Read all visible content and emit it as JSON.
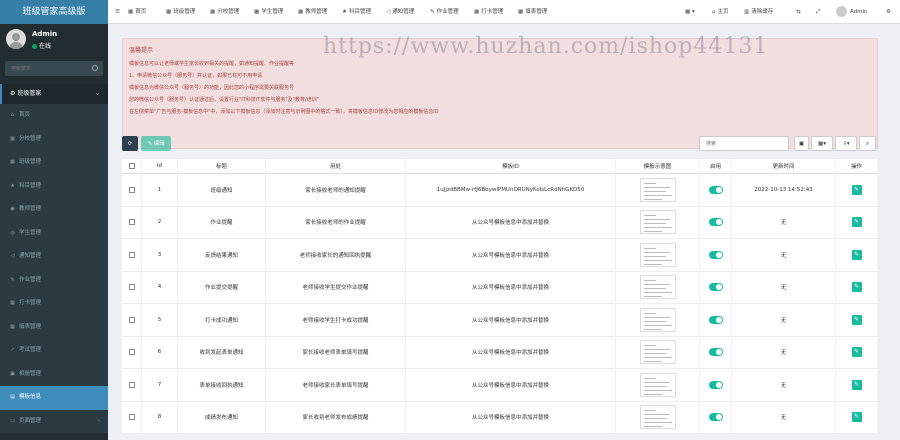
{
  "app": {
    "brand": "班级管家高级版"
  },
  "user": {
    "name": "Admin",
    "status": "在线"
  },
  "sidebar": {
    "search_placeholder": "搜索菜单",
    "group_label": "班级管家",
    "items": [
      {
        "label": "首页",
        "icon": "home-icon"
      },
      {
        "label": "分校管理",
        "icon": "grid-icon"
      },
      {
        "label": "班级管理",
        "icon": "grid-icon"
      },
      {
        "label": "科目管理",
        "icon": "star-icon"
      },
      {
        "label": "教师管理",
        "icon": "user-icon"
      },
      {
        "label": "学生管理",
        "icon": "users-icon"
      },
      {
        "label": "通知管理",
        "icon": "bullhorn-icon"
      },
      {
        "label": "作业管理",
        "icon": "edit-icon"
      },
      {
        "label": "打卡管理",
        "icon": "grid-icon"
      },
      {
        "label": "填表管理",
        "icon": "grid-icon"
      },
      {
        "label": "考试管理",
        "icon": "check-icon"
      },
      {
        "label": "相册管理",
        "icon": "image-icon"
      },
      {
        "label": "模板信息",
        "icon": "table-icon",
        "active": true
      },
      {
        "label": "页面管理",
        "icon": "page-icon"
      }
    ]
  },
  "topbar": {
    "nav": [
      {
        "label": "首页",
        "icon": "grid-icon"
      },
      {
        "label": "班级管理",
        "icon": "grid-icon"
      },
      {
        "label": "分校管理",
        "icon": "grid-icon"
      },
      {
        "label": "学生管理",
        "icon": "grid-icon"
      },
      {
        "label": "教师管理",
        "icon": "grid-icon"
      },
      {
        "label": "科目管理",
        "icon": "star-icon"
      },
      {
        "label": "通知管理",
        "icon": "bullhorn-icon"
      },
      {
        "label": "作业管理",
        "icon": "edit-icon"
      },
      {
        "label": "打卡管理",
        "icon": "grid-icon"
      },
      {
        "label": "填表管理",
        "icon": "grid-icon"
      }
    ],
    "home_label": "主页",
    "clear_cache_label": "清除缓存",
    "admin_label": "Admin"
  },
  "alert": {
    "title": "温馨提示",
    "lines": [
      "模板信息可以让老师或学生家长收到相关的提醒，如通知提醒、作业提醒等",
      "1、申请微信公众号（服务号）并认证，如果已有可不用申请",
      "模板信息为微信公众号（服务号）的功能，因此您的小程序需要关联服务号",
      "您的微信公众号（服务号）认证通过后，设置行业\"IT科技IT软件与服务\"及\"教育/培训\"",
      "在左侧菜单\"广告与服务-模板信息中\"中，添加以下模板信息（添加时注意与示例图中的格式一致），将模板信息ID修改为您相应的模板信息ID"
    ]
  },
  "watermark": "https://www.huzhan.com/ishop44131",
  "toolbar": {
    "add_label": "✎ 编辑",
    "search_placeholder": "搜索"
  },
  "table": {
    "headers": [
      "Id",
      "标题",
      "用处",
      "模板ID",
      "模板示意图",
      "启用",
      "更新时间",
      "操作"
    ],
    "rows": [
      {
        "id": "1",
        "title": "班级通知",
        "usage": "家长接收老师的通知提醒",
        "template_id": "1uJjzdBBMw-rfJ6BbywlPMUnORUNyKoIsLcRdNhGKD50",
        "updated": "2022-10-13 14:52:43"
      },
      {
        "id": "2",
        "title": "作业提醒",
        "usage": "家长接收老师的作业提醒",
        "template_id": "从公众号模板信息中添加并替换",
        "updated": "无"
      },
      {
        "id": "3",
        "title": "反馈结果通知",
        "usage": "老师接收家长的通知回执提醒",
        "template_id": "从公众号模板信息中添加并替换",
        "updated": "无"
      },
      {
        "id": "4",
        "title": "作业提交提醒",
        "usage": "老师接收学生提交作业提醒",
        "template_id": "从公众号模板信息中添加并替换",
        "updated": "无"
      },
      {
        "id": "5",
        "title": "打卡成功通知",
        "usage": "老师接收学生打卡成功提醒",
        "template_id": "从公众号模板信息中添加并替换",
        "updated": "无"
      },
      {
        "id": "6",
        "title": "收到发起表单通知",
        "usage": "家长接收老师表单填写提醒",
        "template_id": "从公众号模板信息中添加并替换",
        "updated": "无"
      },
      {
        "id": "7",
        "title": "表单接收回执通知",
        "usage": "老师接收家长表单填写提醒",
        "template_id": "从公众号模板信息中添加并替换",
        "updated": "无"
      },
      {
        "id": "8",
        "title": "成绩发布通知",
        "usage": "家长收到老师发布成绩提醒",
        "template_id": "从公众号模板信息中添加并替换",
        "updated": "无"
      }
    ]
  }
}
